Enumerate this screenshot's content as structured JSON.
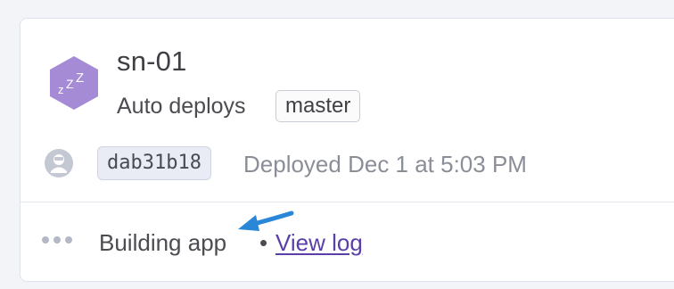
{
  "app": {
    "name": "sn-01",
    "icon": "sleeping-zzz-icon",
    "icon_text": "zZZ",
    "icon_color": "#a58ad6",
    "auto_deploys_label": "Auto deploys",
    "branch": "master"
  },
  "deploy": {
    "avatar_icon": "user-avatar-icon",
    "commit": "dab31b18",
    "status_text": "Deployed Dec 1 at 5:03 PM"
  },
  "build": {
    "status_icon": "ellipsis-icon",
    "status_text": "Building app",
    "separator": "•",
    "view_log_label": "View log",
    "link_color": "#5a3fa8"
  },
  "annotation": {
    "arrow_icon": "pointer-arrow-icon",
    "arrow_color": "#2a86d6"
  }
}
